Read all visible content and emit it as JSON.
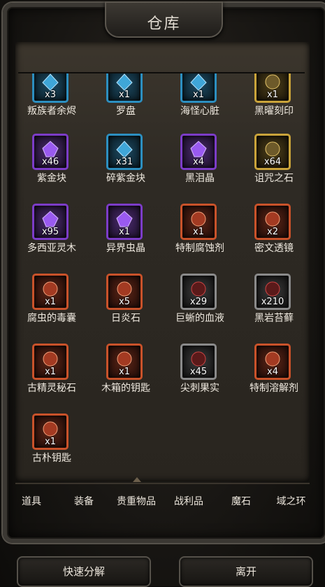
{
  "title": "仓库",
  "items": [
    {
      "name": "叛族者余烬",
      "count": "x3",
      "rarity": "blue",
      "icon": "ember-icon"
    },
    {
      "name": "罗盘",
      "count": "x1",
      "rarity": "blue",
      "icon": "compass-icon"
    },
    {
      "name": "海怪心脏",
      "count": "x1",
      "rarity": "blue",
      "icon": "heart-icon"
    },
    {
      "name": "黑曜刻印",
      "count": "x1",
      "rarity": "gold",
      "icon": "obsidian-icon"
    },
    {
      "name": "紫金块",
      "count": "x46",
      "rarity": "purple",
      "icon": "crystal-icon"
    },
    {
      "name": "碎紫金块",
      "count": "x31",
      "rarity": "blue",
      "icon": "crystal-shard-icon"
    },
    {
      "name": "黑泪晶",
      "count": "x4",
      "rarity": "purple",
      "icon": "black-tear-icon"
    },
    {
      "name": "诅咒之石",
      "count": "x64",
      "rarity": "gold",
      "icon": "cursed-stone-icon"
    },
    {
      "name": "多西亚灵木",
      "count": "x95",
      "rarity": "purple",
      "icon": "wood-icon"
    },
    {
      "name": "异界虫晶",
      "count": "x1",
      "rarity": "purple",
      "icon": "insect-crystal-icon"
    },
    {
      "name": "特制腐蚀剂",
      "count": "x1",
      "rarity": "orange",
      "icon": "potion-icon"
    },
    {
      "name": "密文透镜",
      "count": "x2",
      "rarity": "orange",
      "icon": "lens-icon"
    },
    {
      "name": "腐虫的毒囊",
      "count": "x1",
      "rarity": "orange",
      "icon": "venom-sac-icon"
    },
    {
      "name": "日炎石",
      "count": "x5",
      "rarity": "orange",
      "icon": "sun-stone-icon"
    },
    {
      "name": "巨蜥的血液",
      "count": "x29",
      "rarity": "gray",
      "icon": "blood-icon"
    },
    {
      "name": "黑岩苔藓",
      "count": "x210",
      "rarity": "gray",
      "icon": "moss-icon"
    },
    {
      "name": "古精灵秘石",
      "count": "x1",
      "rarity": "orange",
      "icon": "elf-stone-icon"
    },
    {
      "name": "木箱的钥匙",
      "count": "x1",
      "rarity": "orange",
      "icon": "key-icon"
    },
    {
      "name": "尖刺果实",
      "count": "x45",
      "rarity": "gray",
      "icon": "spiky-fruit-icon"
    },
    {
      "name": "特制溶解剂",
      "count": "x4",
      "rarity": "orange",
      "icon": "potion-icon"
    },
    {
      "name": "古朴钥匙",
      "count": "x1",
      "rarity": "orange",
      "icon": "old-key-icon"
    }
  ],
  "tabs": [
    "道具",
    "装备",
    "贵重物品",
    "战利品",
    "魔石",
    "域之环"
  ],
  "buttons": {
    "decompose": "快速分解",
    "leave": "离开"
  },
  "colors": {
    "purple": "#7c3cc8",
    "blue": "#2c8fc0",
    "gold": "#c9a33a",
    "orange": "#c9522a",
    "gray": "#8a8a8a"
  }
}
